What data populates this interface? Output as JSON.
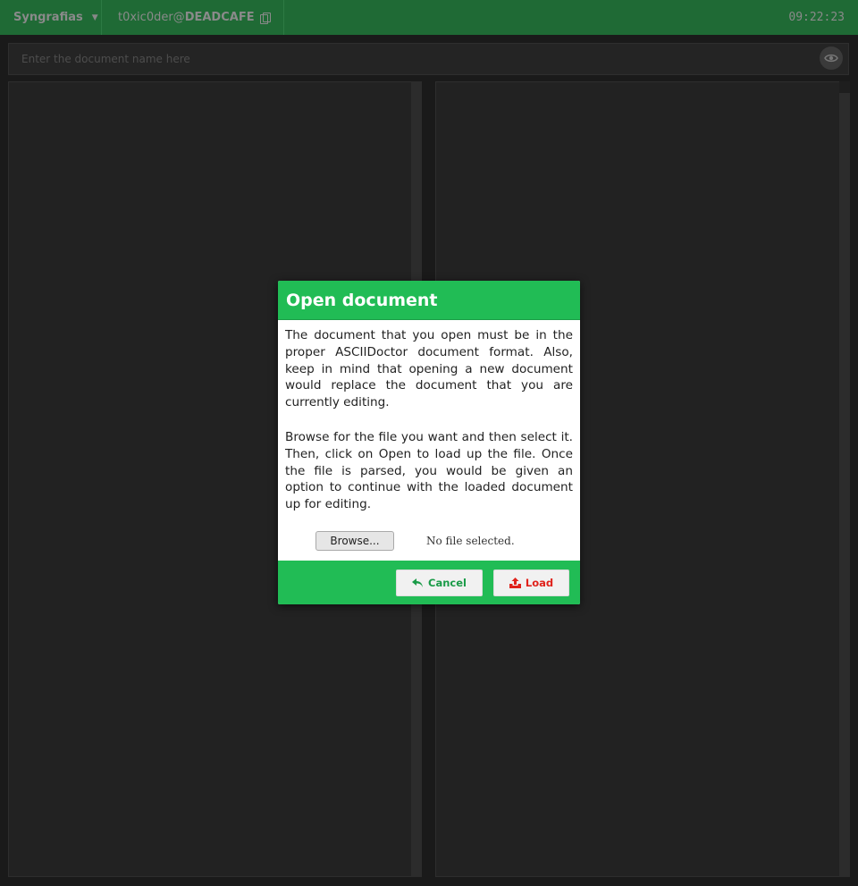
{
  "topbar": {
    "app_name": "Syngrafias",
    "caret": "▼",
    "user": "t0xic0der@",
    "host": "DEADCAFE",
    "clock": "09:22:23"
  },
  "editor": {
    "title_placeholder": "Enter the document name here"
  },
  "modal": {
    "title": "Open document",
    "para1": "The document that you open must be in the proper ASCIIDoctor document format. Also, keep in mind that opening a new document would replace the document that you are currently editing.",
    "para2": "Browse for the file you want and then select it. Then, click on Open to load up the file. Once the file is parsed, you would be given an option to continue with the loaded document up for editing.",
    "browse_label": "Browse...",
    "file_status": "No file selected.",
    "cancel_label": "Cancel",
    "load_label": "Load"
  },
  "colors": {
    "accent": "#21bc55",
    "topbar": "#1f6a35",
    "load_text": "#e0231c"
  }
}
